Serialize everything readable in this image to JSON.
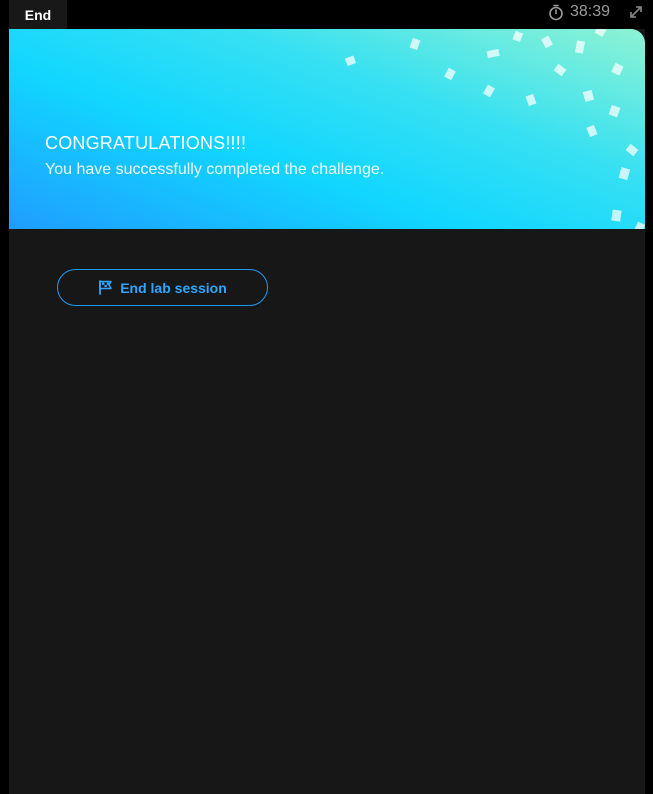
{
  "topbar": {
    "tab_label": "End",
    "timer_value": "38:39",
    "timer_icon": "stopwatch-icon",
    "expand_icon": "expand-icon"
  },
  "banner": {
    "title": "CONGRATULATIONS!!!!",
    "subtitle": "You have successfully completed the challenge."
  },
  "actions": {
    "end_session_label": "End lab session",
    "end_session_icon": "flag-icon"
  },
  "colors": {
    "accent": "#1e9af2",
    "banner_start": "#1f9dff",
    "banner_mid": "#11d6ff",
    "banner_end": "#8ef3d3",
    "panel_bg": "#171717"
  }
}
